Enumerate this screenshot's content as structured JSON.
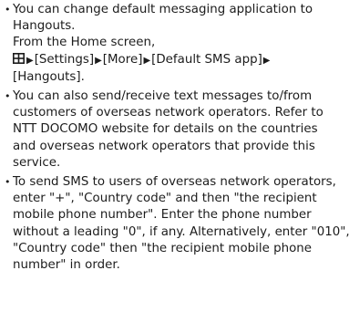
{
  "notes": [
    {
      "bullet": "•",
      "lines": [
        "You can change default messaging application to",
        "Hangouts.",
        "From the Home screen,"
      ],
      "steps": [
        "[Settings]",
        "[More]",
        "[Default SMS app]"
      ],
      "last_step": "[Hangouts].",
      "icon": "menu-grid-icon"
    },
    {
      "bullet": "•",
      "lines": [
        "You can also send/receive text messages to/from",
        "customers of overseas network operators. Refer to",
        "NTT DOCOMO website for details on the countries",
        "and overseas network operators that provide this",
        "service."
      ]
    },
    {
      "bullet": "•",
      "lines": [
        "To send SMS to users of overseas network operators,",
        "enter \"+\", \"Country code\" and then \"the recipient",
        "mobile phone number\". Enter the phone number",
        "without a leading \"0\", if any. Alternatively, enter \"010\",",
        "\"Country code\" then \"the recipient mobile phone",
        "number\" in order."
      ]
    }
  ],
  "arrow": "▶"
}
